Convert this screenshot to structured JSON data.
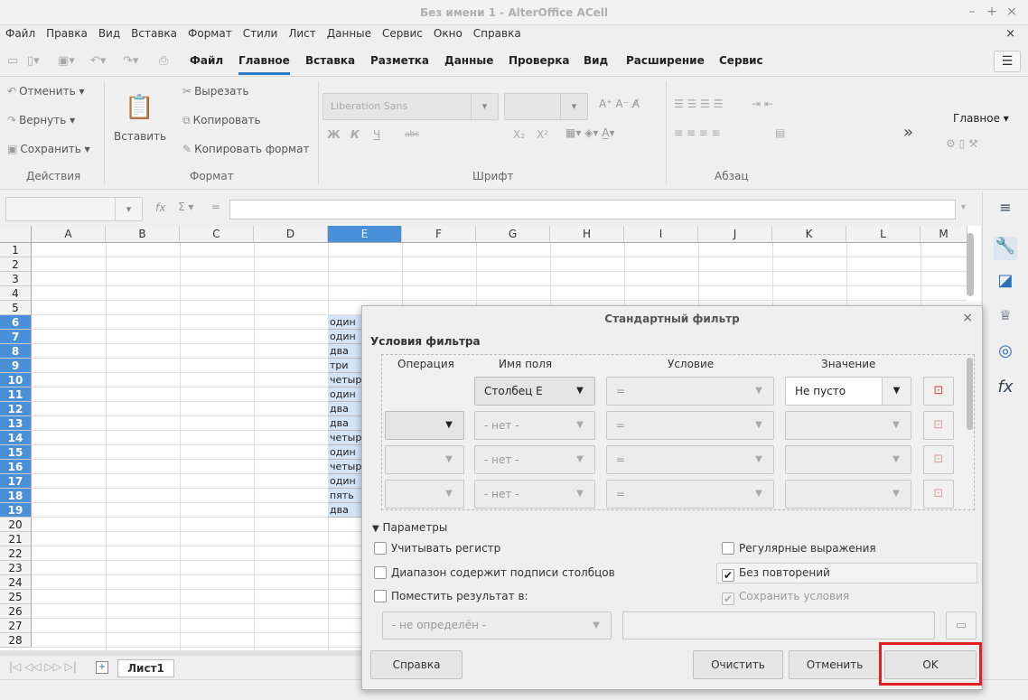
{
  "window": {
    "title": "Без имени 1 - AlterOffice ACell",
    "controls": [
      "–",
      "+",
      "×"
    ]
  },
  "menu": {
    "items": [
      "Файл",
      "Правка",
      "Вид",
      "Вставка",
      "Формат",
      "Стили",
      "Лист",
      "Данные",
      "Сервис",
      "Окно",
      "Справка"
    ],
    "close": "×"
  },
  "tabs": {
    "items": [
      "Файл",
      "Главное",
      "Вставка",
      "Разметка",
      "Данные",
      "Проверка",
      "Вид",
      "Расширение",
      "Сервис"
    ],
    "active": "Главное"
  },
  "ribbon": {
    "actions": {
      "undo": "Отменить",
      "redo": "Вернуть",
      "save": "Сохранить",
      "group": "Действия"
    },
    "format": {
      "paste": "Вставить",
      "cut": "Вырезать",
      "copy": "Копировать",
      "copy_format": "Копировать формат",
      "group": "Формат"
    },
    "font": {
      "name": "Liberation Sans",
      "size": "",
      "group": "Шрифт",
      "bold": "Ж",
      "italic": "К",
      "underline": "Ч",
      "strike": "abc",
      "sub": "X₂",
      "sup": "X²"
    },
    "paragraph": {
      "group": "Абзац"
    },
    "more": "»",
    "styles_dropdown": "Главное"
  },
  "formula": {
    "name_box": "",
    "fx": "fx",
    "sum": "Σ",
    "eq": "=",
    "content": ""
  },
  "grid": {
    "columns": [
      "A",
      "B",
      "C",
      "D",
      "E",
      "F",
      "G",
      "H",
      "I",
      "J",
      "K",
      "L",
      "M"
    ],
    "selected_column": "E",
    "rows": [
      "1",
      "2",
      "3",
      "4",
      "5",
      "6",
      "7",
      "8",
      "9",
      "10",
      "11",
      "12",
      "13",
      "14",
      "15",
      "16",
      "17",
      "18",
      "19",
      "20",
      "21",
      "22",
      "23",
      "24",
      "25",
      "26",
      "27",
      "28"
    ],
    "selected_rows": [
      "6",
      "7",
      "8",
      "9",
      "10",
      "11",
      "12",
      "13",
      "14",
      "15",
      "16",
      "17",
      "18",
      "19"
    ],
    "column_e_values": [
      "один",
      "один",
      "два",
      "три",
      "четыр",
      "один",
      "два",
      "два",
      "четыр",
      "один",
      "четыр",
      "один",
      "пять",
      "два"
    ]
  },
  "sheet": {
    "tab": "Лист1"
  },
  "dialog": {
    "title": "Стандартный фильтр",
    "close": "×",
    "section_conditions": "Условия фильтра",
    "headers": {
      "operation": "Операция",
      "field": "Имя поля",
      "condition": "Условие",
      "value": "Значение"
    },
    "rows": [
      {
        "operation": "",
        "field": "Столбец E",
        "condition": "=",
        "value": "Не пусто"
      },
      {
        "operation": "",
        "field": "- нет -",
        "condition": "=",
        "value": ""
      },
      {
        "operation": "",
        "field": "- нет -",
        "condition": "=",
        "value": ""
      },
      {
        "operation": "",
        "field": "- нет -",
        "condition": "=",
        "value": ""
      }
    ],
    "params_label": "Параметры",
    "options": {
      "case": "Учитывать регистр",
      "regex": "Регулярные выражения",
      "headers": "Диапазон содержит подписи столбцов",
      "no_dup": "Без повторений",
      "copy_to": "Поместить результат в:",
      "keep": "Сохранить условия"
    },
    "copy_target": "- не определён -",
    "buttons": {
      "help": "Справка",
      "clear": "Очистить",
      "cancel": "Отменить",
      "ok": "OK"
    }
  }
}
